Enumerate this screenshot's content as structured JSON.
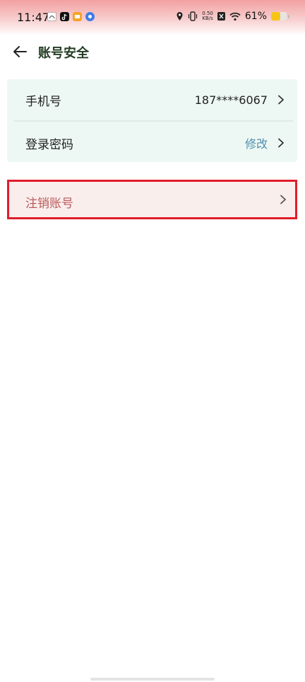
{
  "status_bar": {
    "time": "11:47",
    "net_speed_value": "0.50",
    "net_speed_unit": "KB/s",
    "battery_percent": "61%",
    "battery_level": 0.61
  },
  "header": {
    "title": "账号安全"
  },
  "settings": [
    {
      "label": "手机号",
      "value": "187****6067"
    },
    {
      "label": "登录密码",
      "value": "修改"
    }
  ],
  "danger": {
    "label": "注销账号"
  },
  "colors": {
    "accent_link": "#4f8fae",
    "highlight_border": "#e01d2a",
    "title": "#233d23"
  }
}
